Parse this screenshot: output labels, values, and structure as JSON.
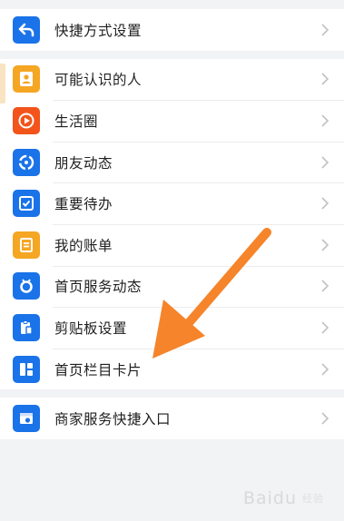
{
  "groups": [
    {
      "items": [
        {
          "label": "快捷方式设置",
          "icon": "back-arrow-icon",
          "color": "#1a73e8"
        }
      ]
    },
    {
      "items": [
        {
          "label": "可能认识的人",
          "icon": "contact-book-icon",
          "color": "#f5a623"
        },
        {
          "label": "生活圈",
          "icon": "play-circle-icon",
          "color": "#f2541b"
        },
        {
          "label": "朋友动态",
          "icon": "refresh-circle-icon",
          "color": "#1a73e8"
        },
        {
          "label": "重要待办",
          "icon": "checklist-icon",
          "color": "#1a73e8"
        },
        {
          "label": "我的账单",
          "icon": "bill-icon",
          "color": "#f5a623"
        },
        {
          "label": "首页服务动态",
          "icon": "service-pin-icon",
          "color": "#1a73e8"
        },
        {
          "label": "剪贴板设置",
          "icon": "clipboard-icon",
          "color": "#1a73e8"
        },
        {
          "label": "首页栏目卡片",
          "icon": "grid-card-icon",
          "color": "#1a73e8"
        }
      ]
    },
    {
      "items": [
        {
          "label": "商家服务快捷入口",
          "icon": "store-icon",
          "color": "#1a73e8"
        }
      ]
    }
  ],
  "annotation": {
    "color": "#f5842a"
  },
  "watermark": {
    "text": "Baidu",
    "sub": "经验"
  }
}
